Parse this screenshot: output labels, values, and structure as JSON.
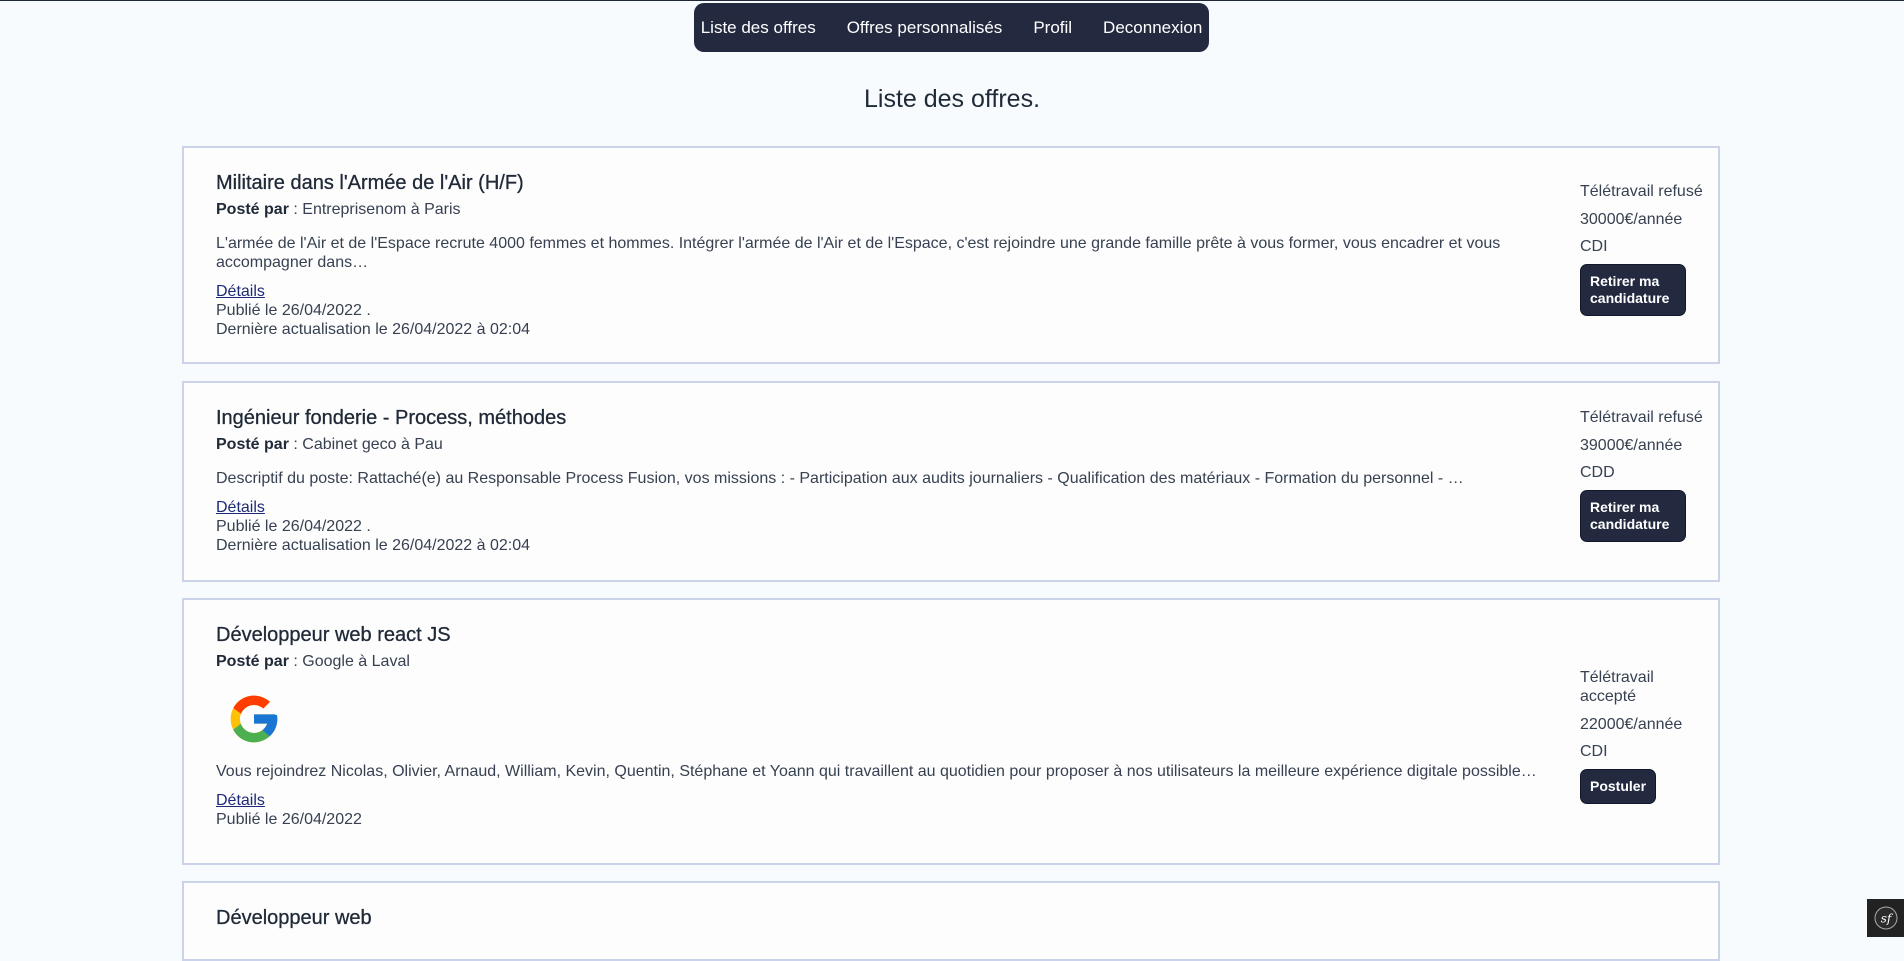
{
  "nav": {
    "items": [
      "Liste des offres",
      "Offres personnalisés",
      "Profil",
      "Deconnexion"
    ]
  },
  "page_title": "Liste des offres.",
  "posted_by_label": "Posté par",
  "offers": [
    {
      "title": "Militaire dans l'Armée de l'Air (H/F)",
      "company": "Entreprisenom à Paris",
      "description": "L'armée de l'Air et de l'Espace recrute 4000 femmes et hommes. Intégrer l'armée de l'Air et de l'Espace, c'est rejoindre une grande famille prête à vous former, vous encadrer et vous accompagner dans…",
      "details_label": "Détails",
      "published": "Publié le 26/04/2022 .",
      "updated": "Dernière actualisation le 26/04/2022 à 02:04",
      "telework": "Télétravail refusé",
      "salary": "30000€/année",
      "contract": "CDI",
      "action_label": "Retirer ma candidature"
    },
    {
      "title": "Ingénieur fonderie - Process, méthodes",
      "company": "Cabinet geco à Pau",
      "description": "Descriptif du poste: Rattaché(e) au Responsable Process Fusion, vos missions : - Participation aux audits journaliers - Qualification des matériaux - Formation du personnel - …",
      "details_label": "Détails",
      "published": "Publié le 26/04/2022 .",
      "updated": "Dernière actualisation le 26/04/2022 à 02:04",
      "telework": "Télétravail refusé",
      "salary": "39000€/année",
      "contract": "CDD",
      "action_label": "Retirer ma candidature"
    },
    {
      "title": "Développeur web react JS",
      "company": "Google à Laval",
      "logo": "google-logo",
      "description": "Vous rejoindrez Nicolas, Olivier, Arnaud, William, Kevin, Quentin, Stéphane et Yoann qui travaillent au quotidien pour proposer à nos utilisateurs la meilleure expérience digitale possible. Vous…",
      "details_label": "Détails",
      "published": "Publié le 26/04/2022",
      "telework": "Télétravail accepté",
      "salary": "22000€/année",
      "contract": "CDI",
      "action_label": "Postuler"
    },
    {
      "title": "Développeur web"
    }
  ],
  "footer_badge_icon": "symfony-icon"
}
